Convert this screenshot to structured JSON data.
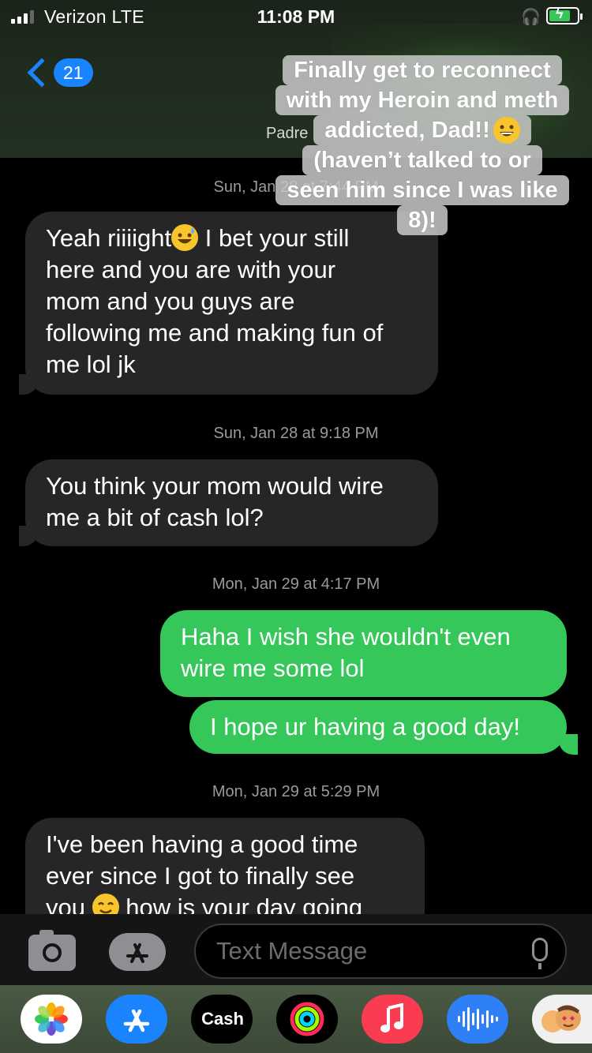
{
  "status_bar": {
    "carrier": "Verizon  LTE",
    "time": "11:08 PM"
  },
  "nav": {
    "unread_count": "21",
    "contact_name": "Padre"
  },
  "caption_overlay": {
    "lines": [
      "Finally get to reconnect",
      "with my Heroin and meth",
      "addicted, Dad!!",
      "(haven’t talked to or",
      "seen him since I was like",
      "8)!"
    ]
  },
  "conversation": {
    "timestamps": [
      "Sun, Jan 28 at 7:44 PM",
      "Sun, Jan 28 at 9:18 PM",
      "Mon, Jan 29 at 4:17 PM",
      "Mon, Jan 29 at 5:29 PM"
    ],
    "messages": [
      {
        "direction": "incoming",
        "lines": [
          "Yeah riiiight",
          " I bet your still",
          "here and you are with your",
          "mom and you guys are",
          "following me and making fun of",
          "me lol jk"
        ]
      },
      {
        "direction": "incoming",
        "lines": [
          "You think your mom would wire",
          "me a bit of cash lol?"
        ]
      },
      {
        "direction": "outgoing",
        "lines": [
          "Haha I wish she wouldn't even",
          "wire me some lol"
        ]
      },
      {
        "direction": "outgoing",
        "lines": [
          "I hope ur having a good day!"
        ]
      },
      {
        "direction": "incoming",
        "lines": [
          "I've been having a good time",
          "ever since I got to finally see",
          "you",
          " how is your day going"
        ]
      }
    ]
  },
  "composer": {
    "placeholder": "Text Message"
  },
  "app_drawer": {
    "cash_label": "Cash",
    "apps": [
      "photos-icon",
      "app-store-icon",
      "apple-cash-icon",
      "activity-icon",
      "music-icon",
      "voice-memo-icon",
      "memoji-icon"
    ]
  },
  "colors": {
    "accent_blue": "#1a84ff",
    "sms_green": "#35c759",
    "incoming_bubble": "#262628"
  }
}
